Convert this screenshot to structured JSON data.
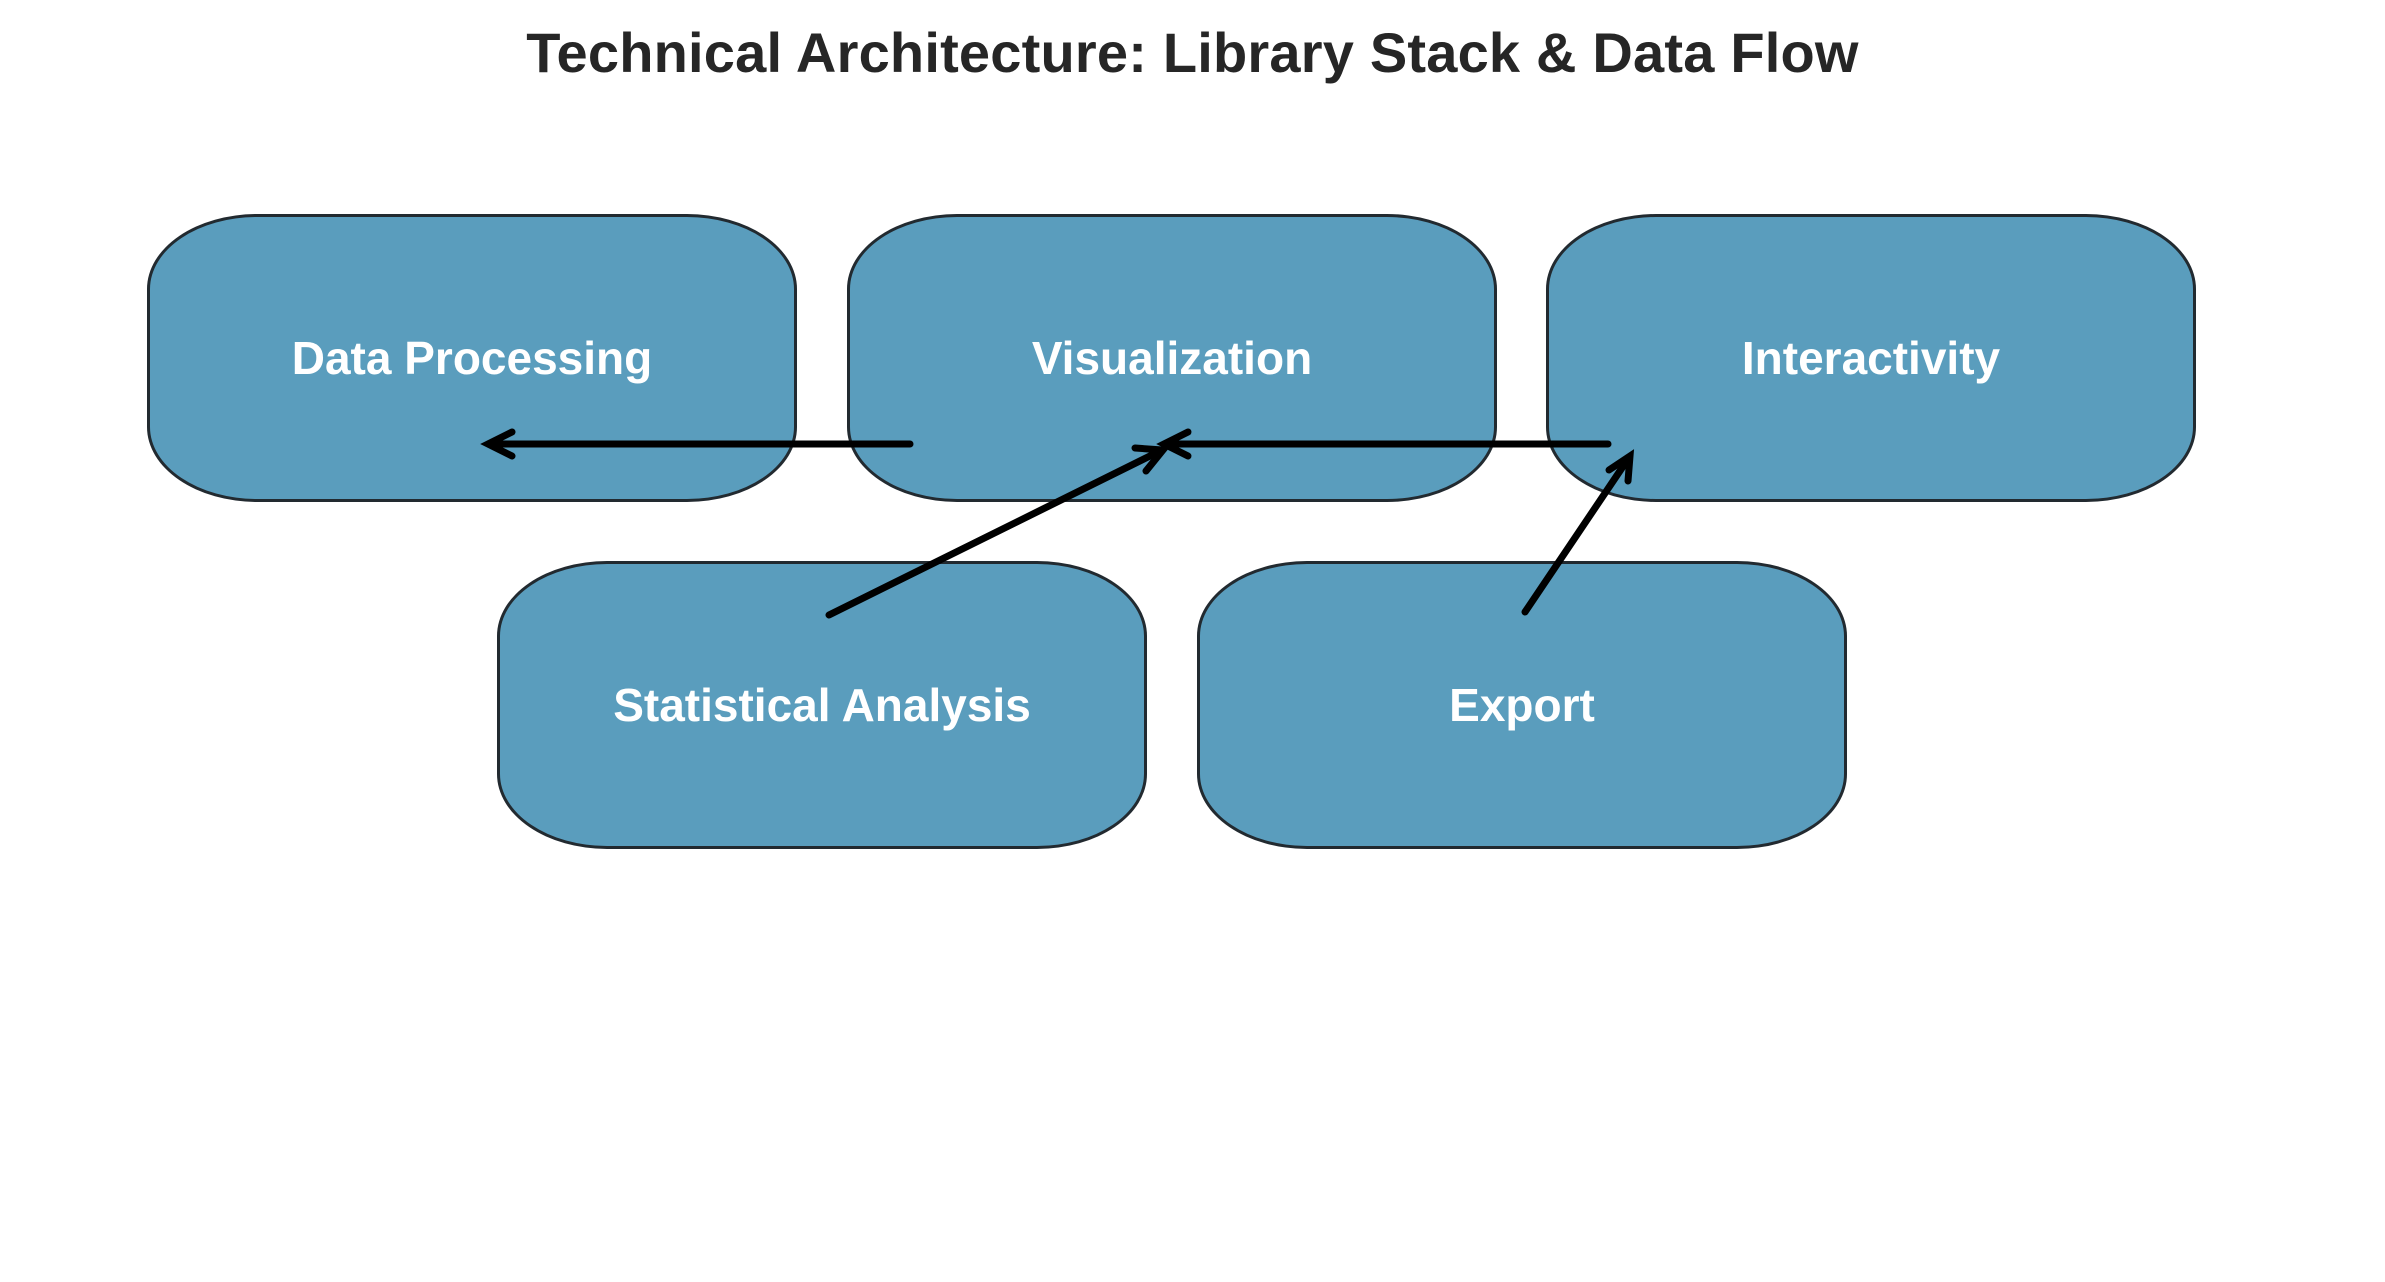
{
  "title": "Technical Architecture: Library Stack & Data Flow",
  "colors": {
    "box_fill": "#5a9dbd",
    "box_border": "#222a30",
    "arrow": "#000000",
    "label": "#ffffff",
    "title": "#262626"
  },
  "nodes": {
    "data_processing": "Data Processing",
    "visualization": "Visualization",
    "interactivity": "Interactivity",
    "statistical_analysis": "Statistical Analysis",
    "export": "Export"
  },
  "edges": [
    {
      "from": "visualization",
      "to": "data_processing"
    },
    {
      "from": "interactivity",
      "to": "visualization"
    },
    {
      "from": "statistical_analysis",
      "to": "visualization"
    },
    {
      "from": "export",
      "to": "interactivity"
    }
  ]
}
